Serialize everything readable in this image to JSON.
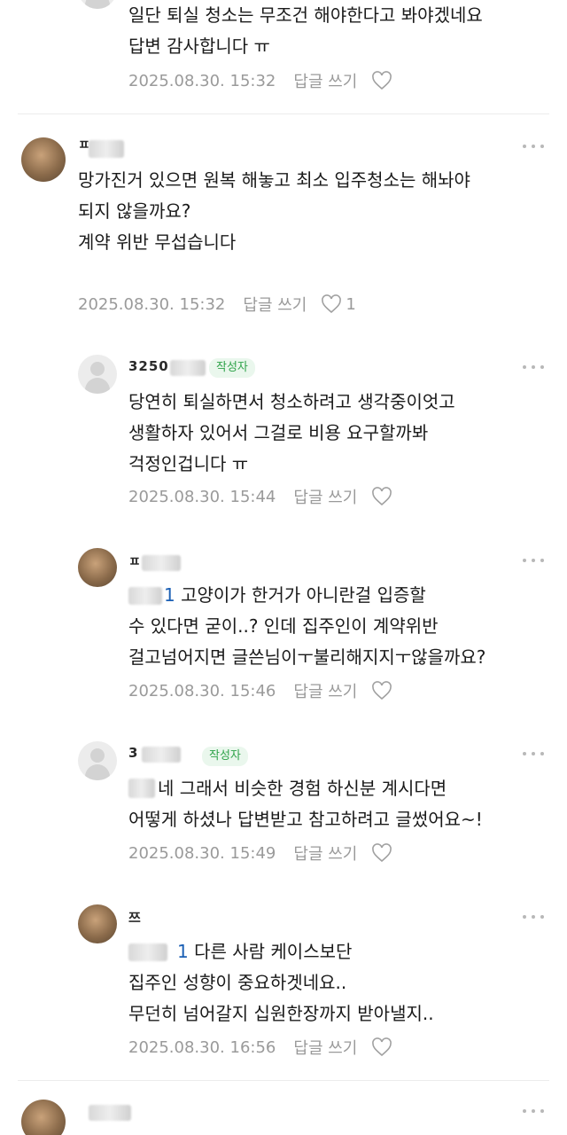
{
  "comments": [
    {
      "lines": [
        "일단 퇴실 청소는 무조건 해야한다고 봐야겠네요",
        "답변 감사합니다 ㅠ"
      ],
      "date": "2025.08.30. 15:32",
      "reply_label": "답글 쓰기"
    },
    {
      "nickname": "ㅍ",
      "lines": [
        "망가진거 있으면 원복 해놓고 최소 입주청소는 해놔야",
        "되지 않을까요?",
        "계약 위반 무섭습니다"
      ],
      "date": "2025.08.30. 15:32",
      "reply_label": "답글 쓰기",
      "like_count": "1"
    },
    {
      "nickname": "3250",
      "badge": "작성자",
      "lines": [
        "당연히 퇴실하면서 청소하려고 생각중이엇고",
        "생활하자 있어서 그걸로 비용 요구할까봐",
        "걱정인겁니다 ㅠ"
      ],
      "date": "2025.08.30. 15:44",
      "reply_label": "답글 쓰기"
    },
    {
      "nickname": "ㅍ",
      "mention": "1",
      "lines": [
        " 고양이가 한거가 아니란걸 입증할",
        "수 있다면 굳이..? 인데 집주인이 계약위반",
        "걸고넘어지면 글쓴님이ㅜ불리해지지ㅜ않을까요?"
      ],
      "date": "2025.08.30. 15:46",
      "reply_label": "답글 쓰기"
    },
    {
      "nickname": "3",
      "badge": "작성자",
      "mention": "",
      "lines": [
        " 네 그래서 비슷한 경험 하신분 계시다면",
        "어떻게 하셨나 답변받고 참고하려고 글썼어요~!"
      ],
      "date": "2025.08.30. 15:49",
      "reply_label": "답글 쓰기"
    },
    {
      "nickname": "쯔",
      "mention": "1",
      "lines": [
        " 다른 사람 케이스보단",
        "집주인 성향이 중요하겟네요..",
        "무던히 넘어갈지 십원한장까지 받아낼지.."
      ],
      "date": "2025.08.30. 16:56",
      "reply_label": "답글 쓰기"
    }
  ]
}
